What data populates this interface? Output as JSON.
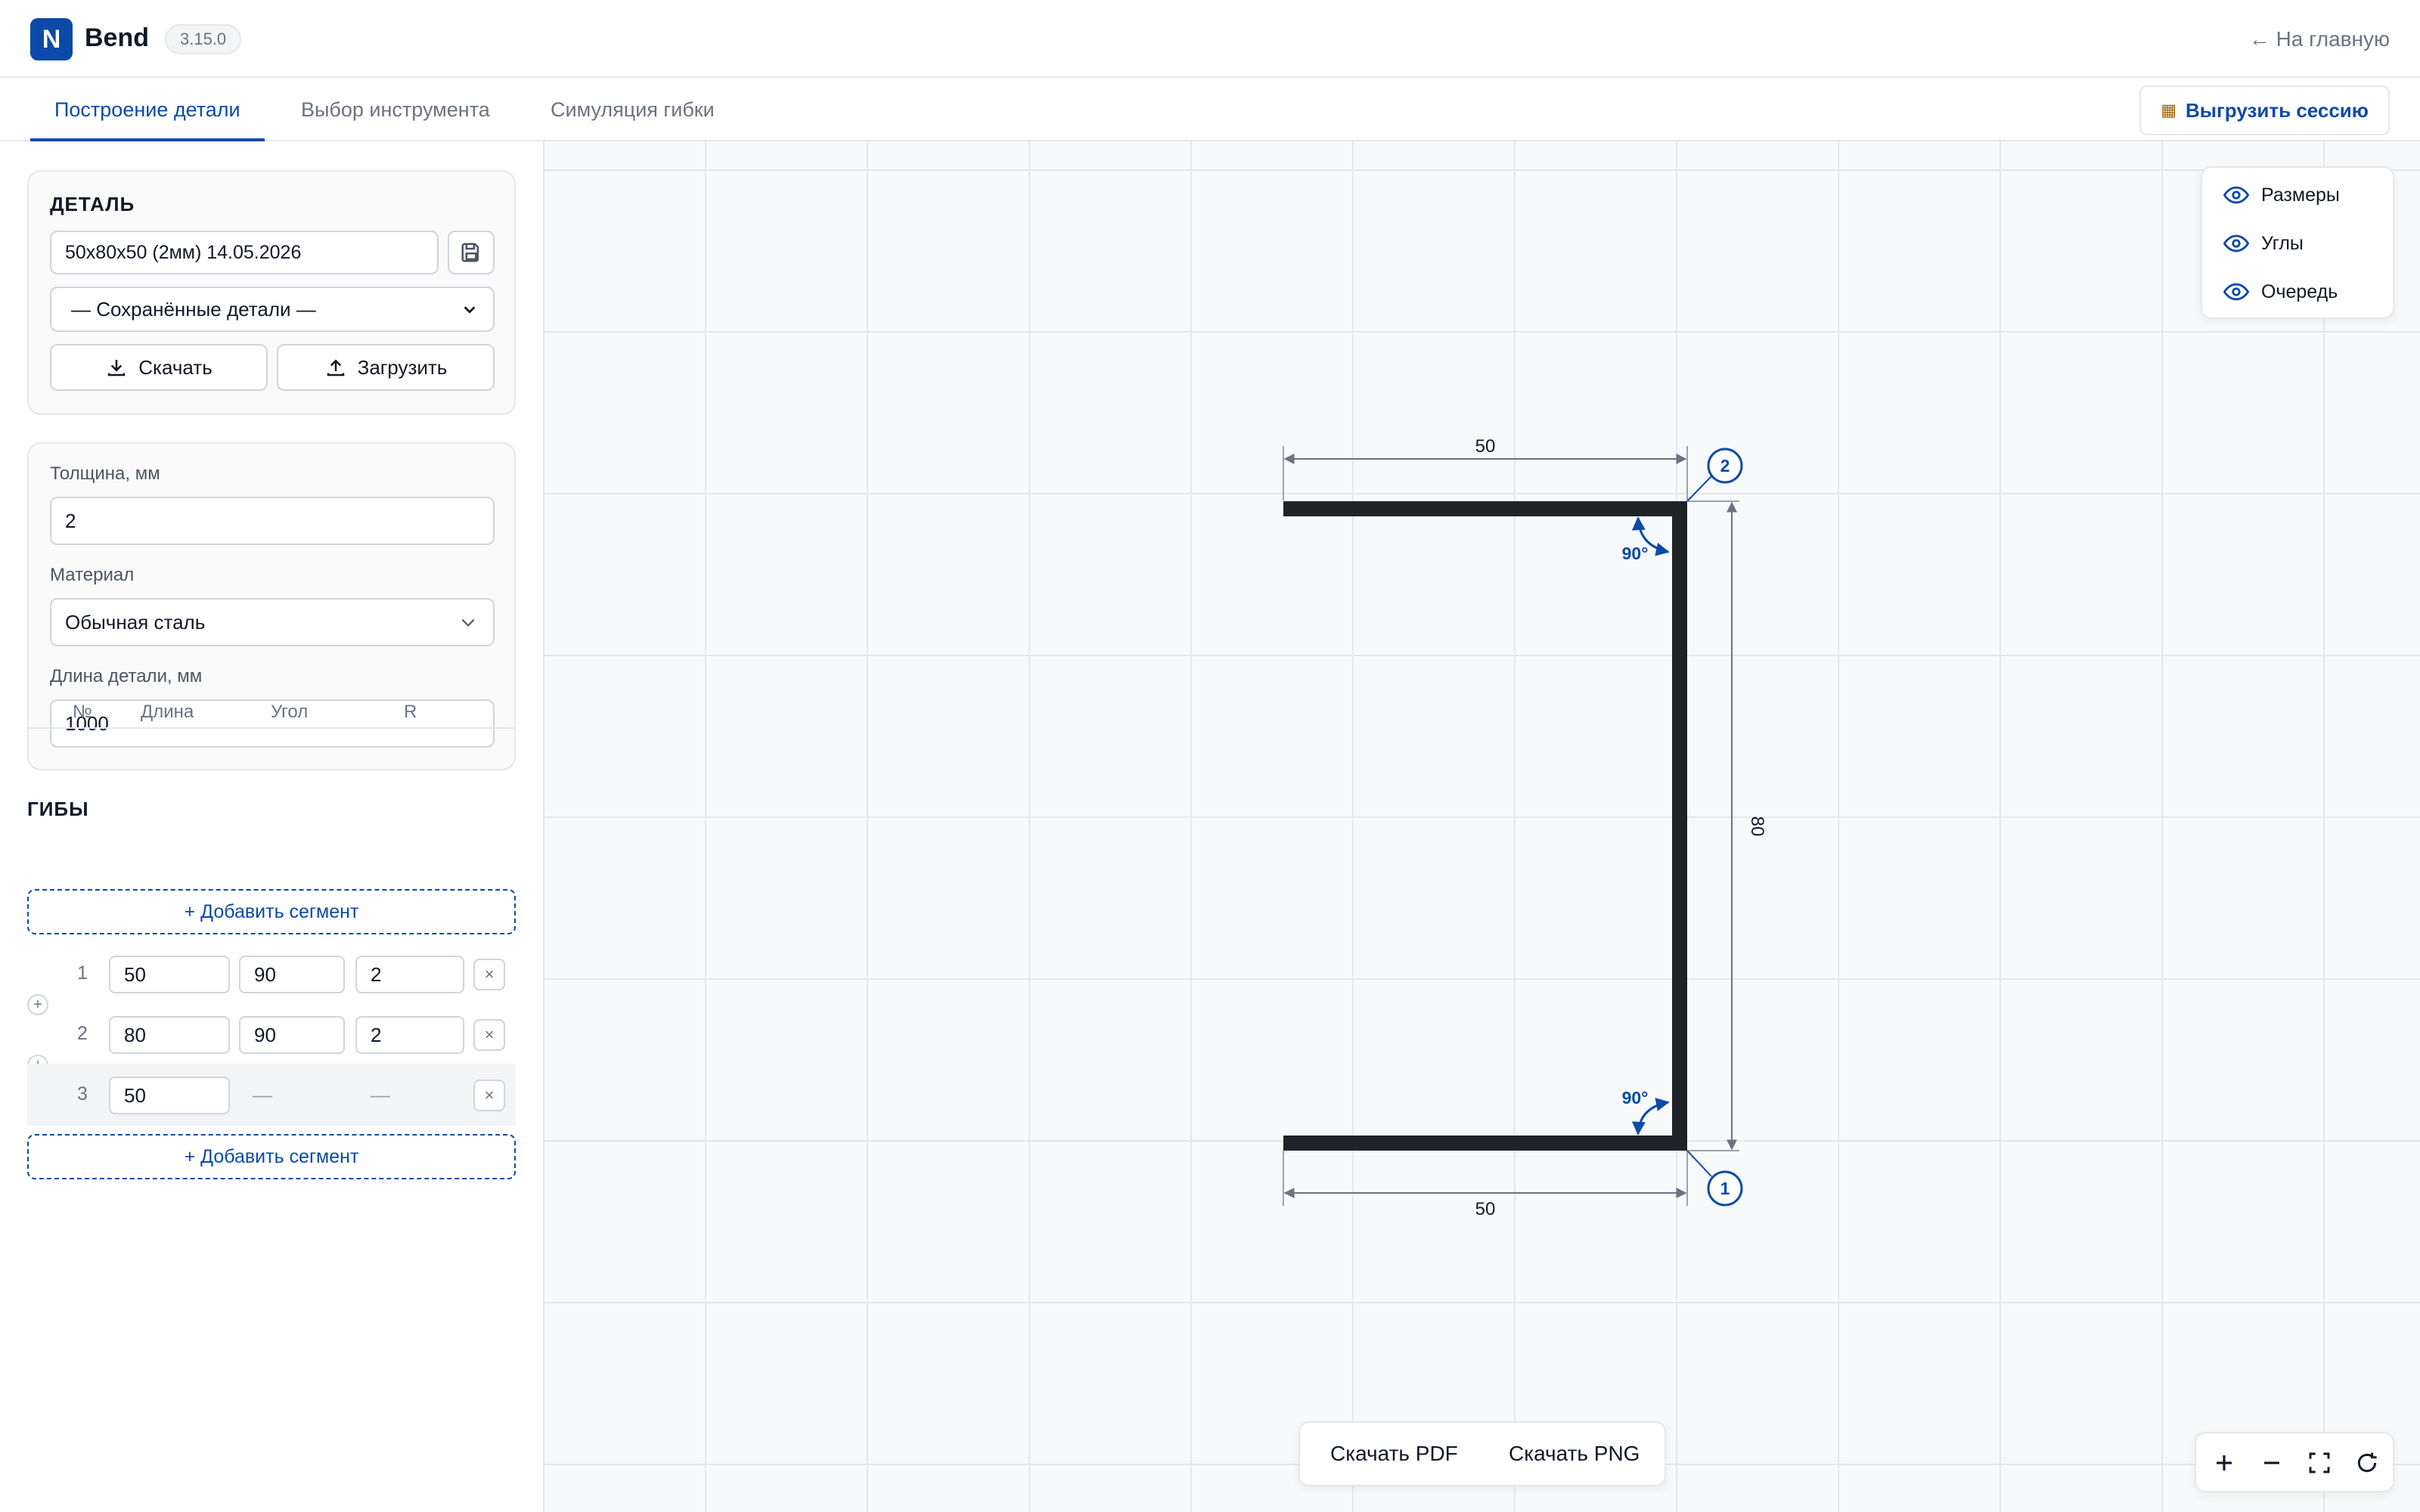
{
  "header": {
    "logo_letter": "N",
    "app_title": "Bend",
    "version": "3.15.0",
    "home_link": "← На главную"
  },
  "tabs": [
    {
      "label": "Построение детали",
      "active": true
    },
    {
      "label": "Выбор инструмента",
      "active": false
    },
    {
      "label": "Симуляция гибки",
      "active": false
    }
  ],
  "export_session_label": "Выгрузить сессию",
  "detail": {
    "title": "ДЕТАЛЬ",
    "name_value": "50x80x50 (2мм) 14.05.2026",
    "saved_select": "— Сохранённые детали —",
    "download_label": "Скачать",
    "upload_label": "Загрузить"
  },
  "params": {
    "thickness_label": "Толщина, мм",
    "thickness_value": "2",
    "material_label": "Материал",
    "material_value": "Обычная сталь",
    "length_label": "Длина детали, мм",
    "length_value": "1000"
  },
  "bends": {
    "title": "ГИБЫ",
    "columns": [
      "№",
      "Длина",
      "Угол",
      "R"
    ],
    "add_segment_label": "+ Добавить сегмент",
    "rows": [
      {
        "num": "1",
        "length": "50",
        "angle": "90",
        "r": "2"
      },
      {
        "num": "2",
        "length": "80",
        "angle": "90",
        "r": "2"
      },
      {
        "num": "3",
        "length": "50",
        "angle": "—",
        "r": "—"
      }
    ],
    "delete_symbol": "×",
    "insert_symbol": "+"
  },
  "drawing": {
    "dim_top": "50",
    "dim_bottom": "50",
    "dim_right": "80",
    "angle_top": "90°",
    "angle_bottom": "90°",
    "bend_markers": [
      "2",
      "1"
    ],
    "accent_color": "#0b4aa8",
    "profile_color": "#1f2328"
  },
  "layers": [
    {
      "label": "Размеры",
      "icon": "eye-icon"
    },
    {
      "label": "Углы",
      "icon": "eye-icon"
    },
    {
      "label": "Очередь",
      "icon": "eye-icon"
    }
  ],
  "downloads": {
    "pdf_label": "Скачать PDF",
    "png_label": "Скачать PNG"
  },
  "zoom_controls": [
    "zoom-in-icon",
    "zoom-out-icon",
    "fit-screen-icon",
    "reset-icon"
  ]
}
